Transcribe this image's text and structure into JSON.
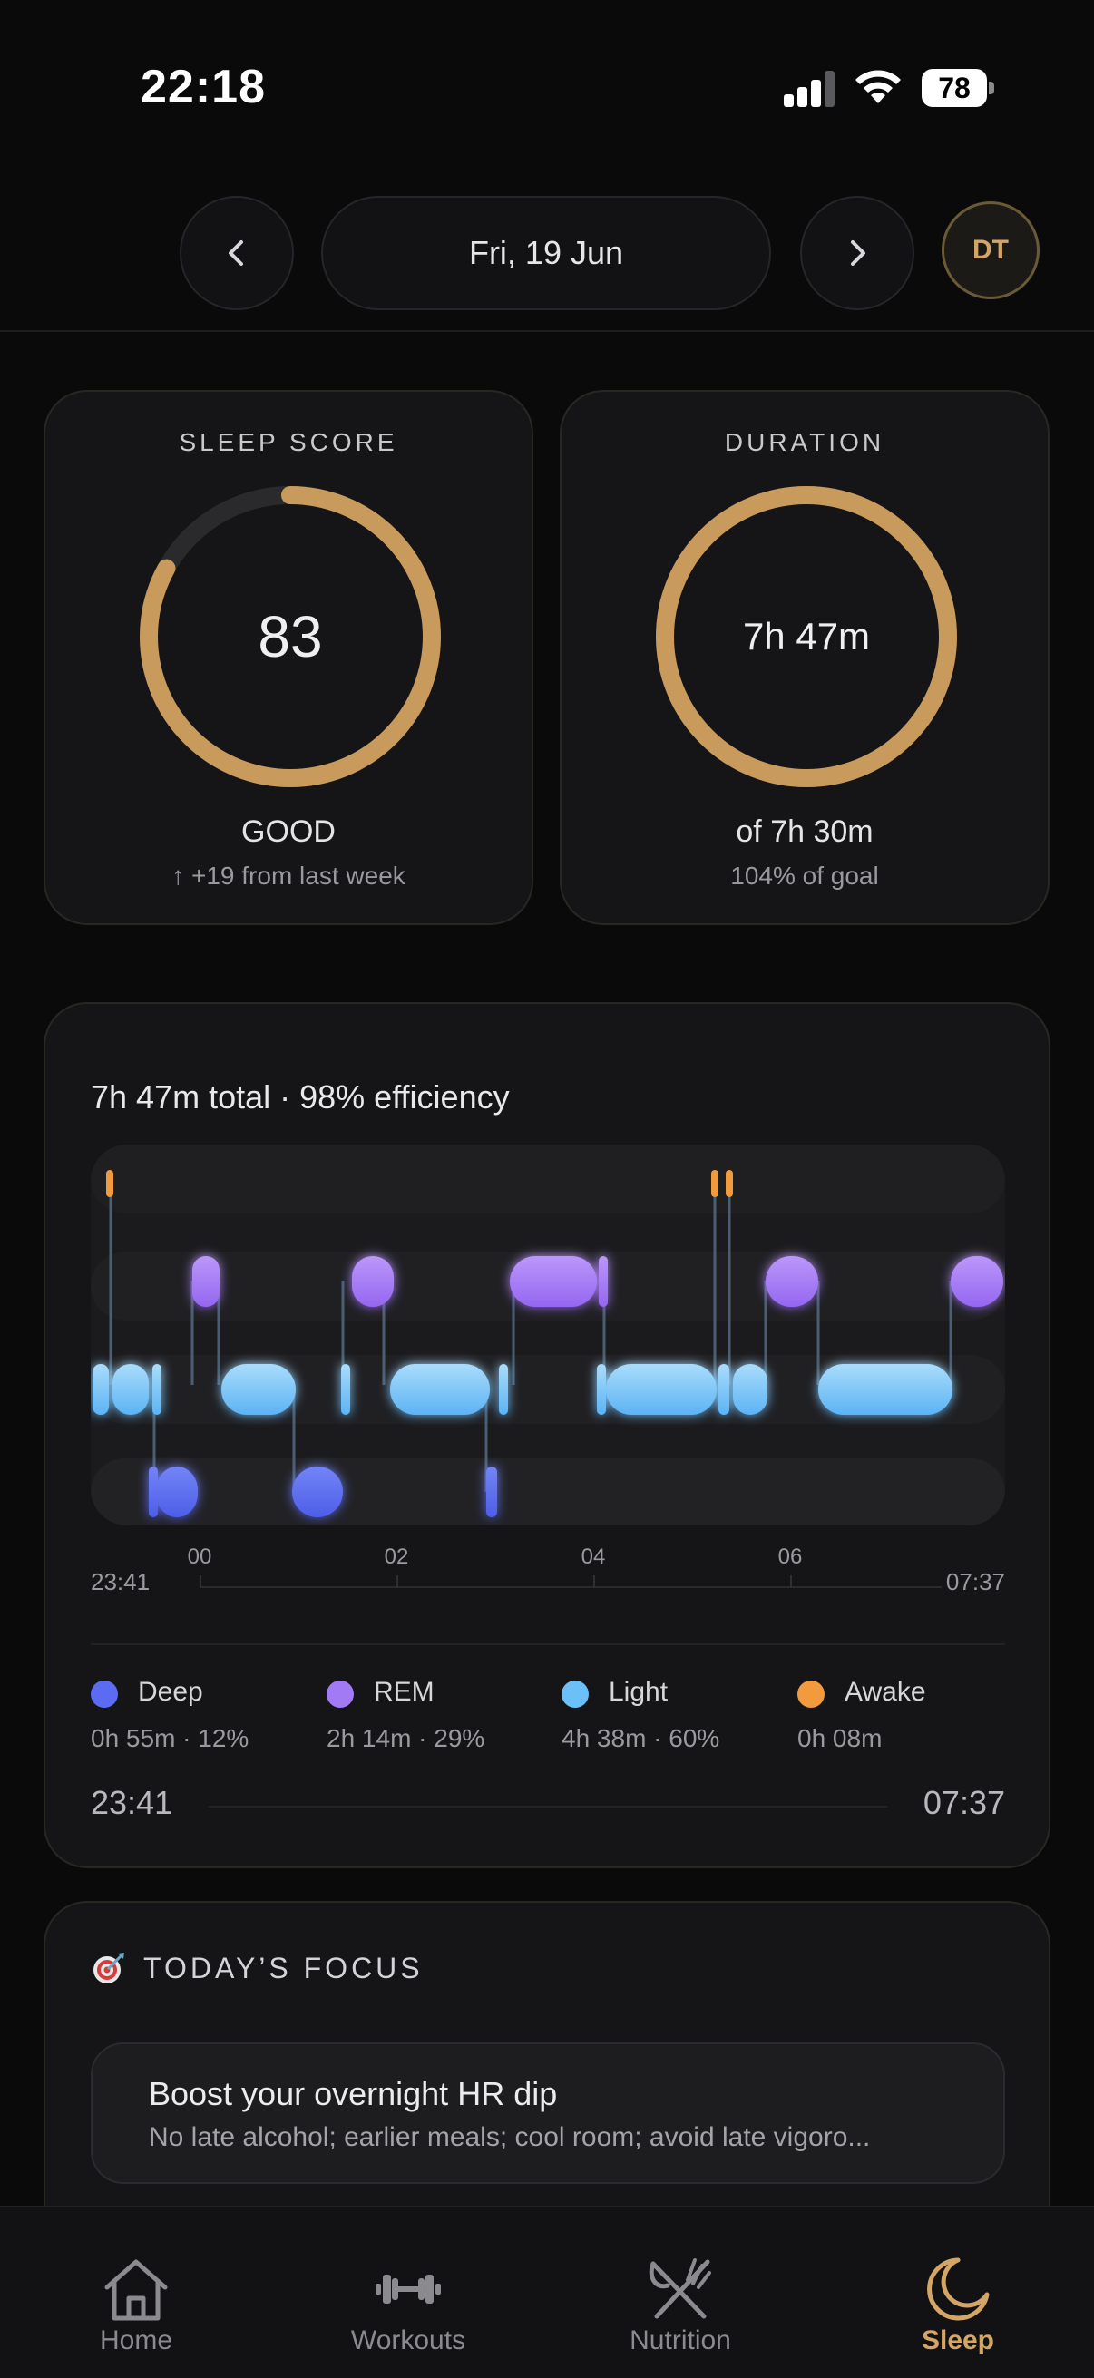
{
  "status_bar": {
    "time": "22:18",
    "battery": "78"
  },
  "date_nav": {
    "date_label": "Fri, 19 Jun",
    "avatar_initials": "DT"
  },
  "sleep_score": {
    "label": "SLEEP SCORE",
    "value": "83",
    "rating": "GOOD",
    "change": "↑ +19 from last week",
    "ring_fraction": 0.83,
    "accent_color": "#c89b5c"
  },
  "duration": {
    "label": "DURATION",
    "value": "7h 47m",
    "goal": "of 7h 30m",
    "goal_percent": "104% of goal",
    "ring_fraction": 1.0
  },
  "hypnogram": {
    "title": "7h 47m total · 98% efficiency",
    "start_time": "23:41",
    "end_time": "07:37",
    "tick_labels": [
      "00",
      "02",
      "04",
      "06"
    ],
    "stage_colors": {
      "deep": "#5c6cf2",
      "rem": "#a27af5",
      "light": "#6cc0f8",
      "awake": "#f29a3e"
    },
    "legend": [
      {
        "name": "Deep",
        "stat": "0h 55m · 12%",
        "color": "#5c6cf2"
      },
      {
        "name": "REM",
        "stat": "2h 14m · 29%",
        "color": "#a27af5"
      },
      {
        "name": "Light",
        "stat": "4h 38m · 60%",
        "color": "#6cc0f8"
      },
      {
        "name": "Awake",
        "stat": "0h 08m",
        "color": "#f29a3e"
      }
    ],
    "range_start": "23:41",
    "range_end": "07:37"
  },
  "focus": {
    "title": "TODAY’S FOCUS",
    "item_title": "Boost your overnight HR dip",
    "item_desc": "No late alcohol; earlier meals; cool room; avoid late vigoro..."
  },
  "tab_bar": {
    "tabs": [
      {
        "label": "Home",
        "icon": "home-icon"
      },
      {
        "label": "Workouts",
        "icon": "dumbbell-icon"
      },
      {
        "label": "Nutrition",
        "icon": "fork-knife-icon"
      },
      {
        "label": "Sleep",
        "icon": "moon-icon"
      }
    ],
    "active": "Sleep"
  }
}
